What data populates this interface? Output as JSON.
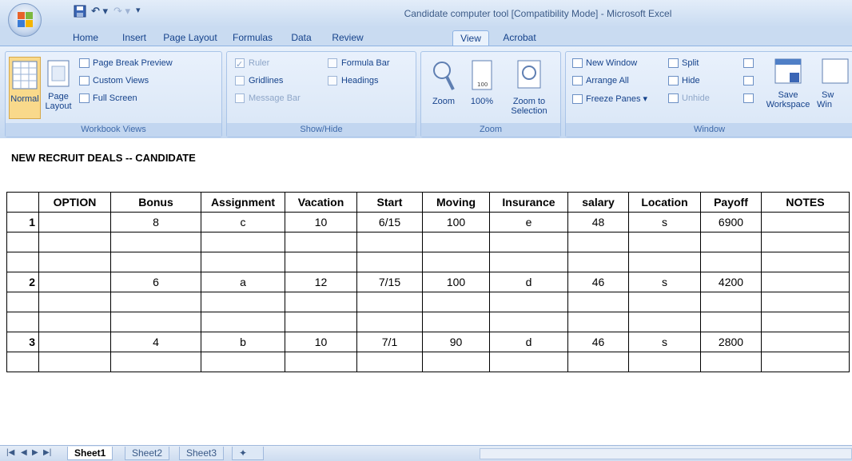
{
  "window": {
    "title": "Candidate computer tool  [Compatibility Mode] - Microsoft Excel"
  },
  "colors": {
    "ribbon": "#d3e1f3",
    "accent": "#15428b"
  },
  "tabs": [
    "Home",
    "Insert",
    "Page Layout",
    "Formulas",
    "Data",
    "Review",
    "View",
    "Acrobat"
  ],
  "active_tab": "View",
  "ribbon": {
    "workbook_views": {
      "label": "Workbook Views",
      "normal": "Normal",
      "page_layout_1": "Page",
      "page_layout_2": "Layout",
      "page_break_preview": "Page Break Preview",
      "custom_views": "Custom Views",
      "full_screen": "Full Screen"
    },
    "show_hide": {
      "label": "Show/Hide",
      "ruler": "Ruler",
      "gridlines": "Gridlines",
      "message_bar": "Message Bar",
      "formula_bar": "Formula Bar",
      "headings": "Headings"
    },
    "zoom": {
      "label": "Zoom",
      "zoom": "Zoom",
      "hundred": "100%",
      "zoom_to_1": "Zoom to",
      "zoom_to_2": "Selection"
    },
    "window": {
      "label": "Window",
      "new_window": "New Window",
      "arrange_all": "Arrange All",
      "freeze_panes": "Freeze Panes ▾",
      "split": "Split",
      "hide": "Hide",
      "unhide": "Unhide",
      "save_1": "Save",
      "save_2": "Workspace",
      "switch": "Sw",
      "switch_2": "Win"
    }
  },
  "sheet": {
    "title": "NEW RECRUIT DEALS -- CANDIDATE",
    "headers": [
      "OPTION",
      "Bonus",
      "Assignment",
      "Vacation",
      "Start",
      "Moving",
      "Insurance",
      "salary",
      "Location",
      "Payoff",
      "NOTES"
    ],
    "rows": [
      [
        "1",
        "8",
        "c",
        "10",
        "6/15",
        "100",
        "e",
        "48",
        "s",
        "6900",
        ""
      ],
      [
        "",
        "",
        "",
        "",
        "",
        "",
        "",
        "",
        "",
        "",
        ""
      ],
      [
        "",
        "",
        "",
        "",
        "",
        "",
        "",
        "",
        "",
        "",
        ""
      ],
      [
        "2",
        "6",
        "a",
        "12",
        "7/15",
        "100",
        "d",
        "46",
        "s",
        "4200",
        ""
      ],
      [
        "",
        "",
        "",
        "",
        "",
        "",
        "",
        "",
        "",
        "",
        ""
      ],
      [
        "",
        "",
        "",
        "",
        "",
        "",
        "",
        "",
        "",
        "",
        ""
      ],
      [
        "3",
        "4",
        "b",
        "10",
        "7/1",
        "90",
        "d",
        "46",
        "s",
        "2800",
        ""
      ],
      [
        "",
        "",
        "",
        "",
        "",
        "",
        "",
        "",
        "",
        "",
        ""
      ]
    ]
  },
  "sheet_tabs": [
    "Sheet1",
    "Sheet2",
    "Sheet3"
  ],
  "active_sheet": "Sheet1"
}
